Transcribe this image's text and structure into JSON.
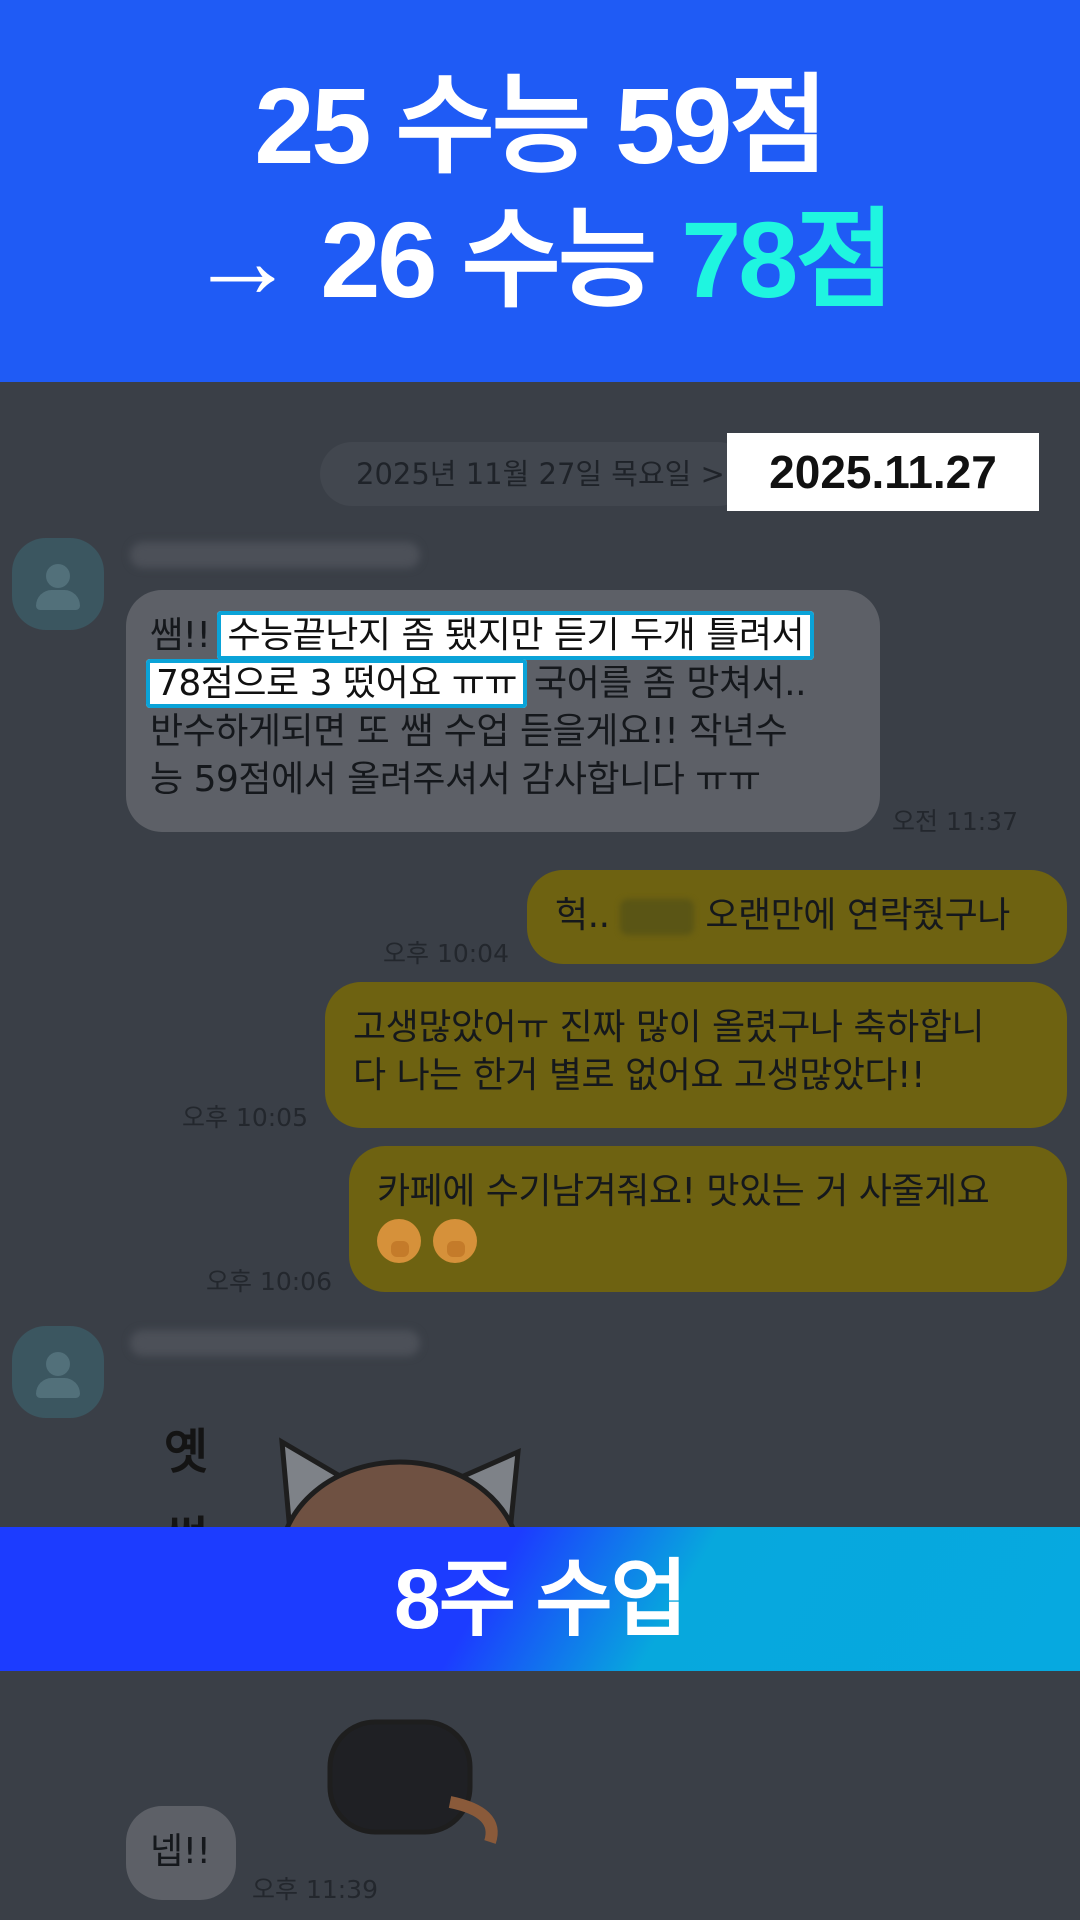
{
  "header": {
    "line1": "25 수능 59점",
    "line2_prefix": "→ 26 수능 ",
    "line2_accent": "78점",
    "colors": {
      "background": "#1f5bf5",
      "accent": "#1ff5e0"
    }
  },
  "chat": {
    "date_divider": "2025년 11월 27일 목요일 >",
    "date_stamp": "2025.11.27",
    "messages": [
      {
        "side": "in",
        "lines": [
          {
            "pre": "쌤!! ",
            "hl": "수능끝난지 좀 됐지만 듣기 두개 틀려서"
          },
          {
            "hl": "78점으로 3 떴어요 ㅠㅠ",
            "post": " 국어를 좀 망쳐서.."
          },
          {
            "text": "반수하게되면 또 쌤 수업 듣을게요!! 작년수"
          },
          {
            "text": "능 59점에서 올려주셔서 감사합니다 ㅠㅠ"
          }
        ],
        "time": "오전 11:37"
      },
      {
        "side": "out",
        "pre": "헉.. ",
        "post": " 오랜만에 연락줬구나",
        "time": "오후 10:04"
      },
      {
        "side": "out",
        "lines": [
          "고생많았어ㅠ 진짜 많이 올렸구나 축하합니",
          "다 나는 한거 별로 없어요 고생많았다!!"
        ],
        "time": "오후 10:05"
      },
      {
        "side": "out",
        "lines": [
          "카페에 수기남겨줘요! 맛있는 거 사줄게요"
        ],
        "emoji": "hand-over-mouth",
        "time": "오후 10:06"
      },
      {
        "side": "in",
        "sticker_text": [
          "옛",
          "썹"
        ],
        "sticker": "cat-sticker"
      },
      {
        "side": "in",
        "text": "넵!!",
        "time": "오후 11:39"
      }
    ]
  },
  "banner": {
    "text": "8주 수업",
    "gradient": [
      "#1c3cff",
      "#06a9e0"
    ]
  }
}
